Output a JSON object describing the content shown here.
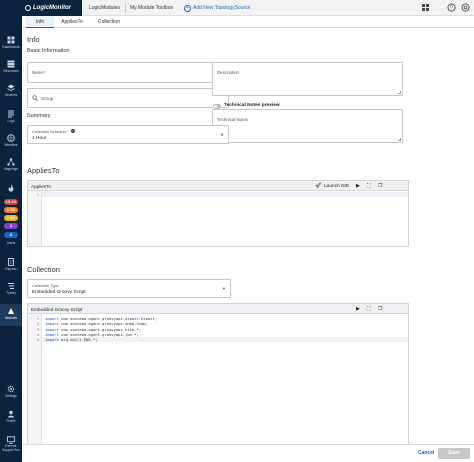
{
  "nav": {
    "items": [
      {
        "label": "Dashboards"
      },
      {
        "label": "Resources"
      },
      {
        "label": "Services"
      },
      {
        "label": "Logs"
      },
      {
        "label": "Websites"
      },
      {
        "label": "Mappings"
      },
      {
        "label": "Alerts"
      },
      {
        "label": "Reports"
      },
      {
        "label": "Traces"
      },
      {
        "label": "Modules"
      },
      {
        "label": "Settings"
      },
      {
        "label": "Profile"
      },
      {
        "label": "Remote Support Ses"
      }
    ],
    "alert_counts": [
      "15.3K",
      "1.7K",
      "7.6K",
      "1",
      "8"
    ],
    "alert_colors": [
      "#d63a2f",
      "#f07b22",
      "#e9b21c",
      "#8a3fd1",
      "#1866c7"
    ]
  },
  "header": {
    "logo": "LogicMonitor",
    "tab1": "LogicModules",
    "tab2": "My Module Toolbox",
    "add_topology": "Add New TopologySource"
  },
  "tabs": [
    "Info",
    "AppliesTo",
    "Collection"
  ],
  "info": {
    "title": "Info",
    "basic_info": "Basic Information",
    "name_placeholder": "Name*",
    "group_placeholder": "Group",
    "description_placeholder": "Description",
    "tech_notes_preview": "Technical Notes preview",
    "tech_notes_placeholder": "Technical Notes",
    "summary": "Summary",
    "collection_schedule_label": "Collection Schedule",
    "collection_schedule_value": "1 Hour"
  },
  "applies_to": {
    "title": "AppliesTo",
    "editor_title": "AppliesTo",
    "launch_ide": "Launch IDE",
    "line_number": "1"
  },
  "collection": {
    "title": "Collection",
    "type_label": "Collection Type",
    "type_value": "Embedded Groovy Script",
    "editor_title": "Embedded Groovy Script",
    "lines": [
      {
        "n": "1",
        "kw": "import",
        "rest": " com.santaba.agent.groovyapi.expect.Expect;"
      },
      {
        "n": "2",
        "kw": "import",
        "rest": " com.santaba.agent.groovyapi.snmp.Snmp;"
      },
      {
        "n": "3",
        "kw": "import",
        "rest": " com.santaba.agent.groovyapi.http.*;"
      },
      {
        "n": "4",
        "kw": "import",
        "rest": " com.santaba.agent.groovyapi.jmx.*;"
      },
      {
        "n": "5",
        "kw": "import",
        "rest": " org.xbill.DNS.*;"
      }
    ]
  },
  "footer": {
    "cancel": "Cancel",
    "save": "Save"
  }
}
